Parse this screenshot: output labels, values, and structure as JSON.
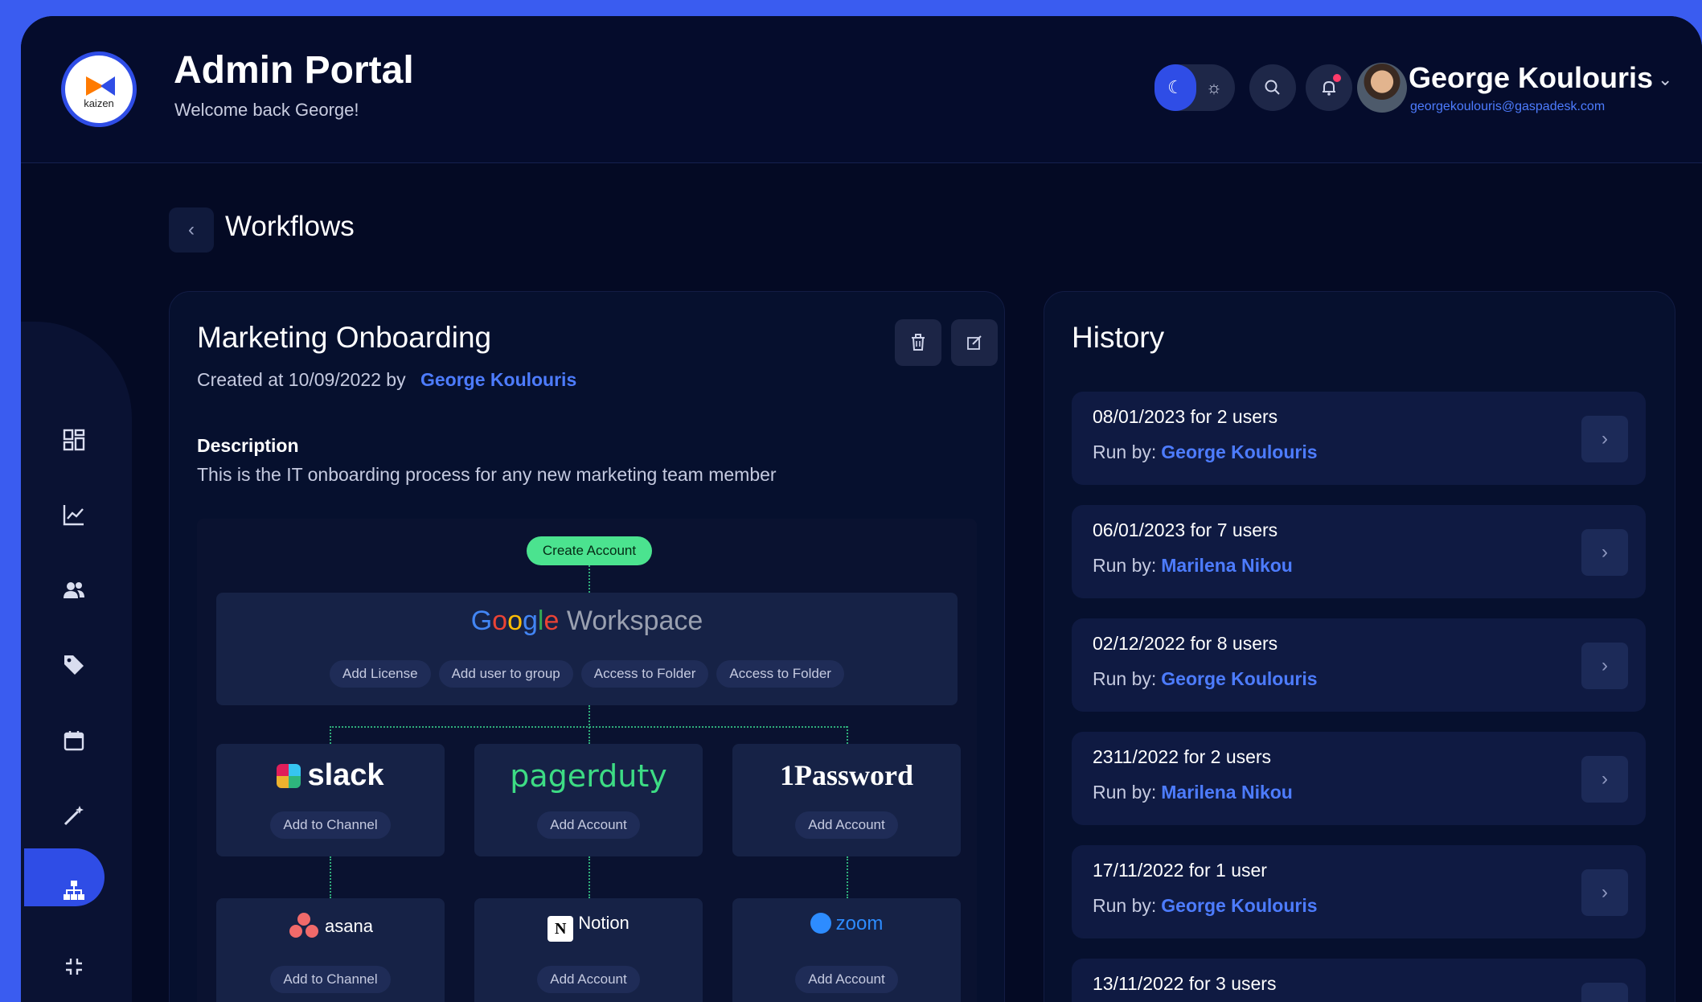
{
  "header": {
    "logo_text": "kaizen",
    "title": "Admin Portal",
    "subtitle": "Welcome back George!",
    "user_name": "George Koulouris",
    "user_email": "georgekoulouris@gaspadesk.com"
  },
  "icons": {
    "theme_dark": "moon-icon",
    "theme_light": "sun-icon",
    "search": "search-icon",
    "notifications": "bell-icon",
    "user_menu": "chevron-down-icon",
    "back": "chevron-left-icon",
    "delete": "trash-icon",
    "edit": "edit-icon",
    "history_open": "chevron-right-icon"
  },
  "sidebar": {
    "items": [
      {
        "icon": "dashboard-icon"
      },
      {
        "icon": "chart-icon"
      },
      {
        "icon": "users-icon"
      },
      {
        "icon": "tag-icon"
      },
      {
        "icon": "calendar-icon"
      },
      {
        "icon": "magic-wand-icon"
      },
      {
        "icon": "workflow-icon",
        "active": true
      },
      {
        "icon": "collapse-icon"
      }
    ]
  },
  "page": {
    "title": "Workflows"
  },
  "workflow": {
    "title": "Marketing Onboarding",
    "created_text": "Created at 10/09/2022 by",
    "author": "George Koulouris",
    "description_label": "Description",
    "description": "This is the IT onboarding process for any new marketing team member",
    "trigger": "Create Account",
    "google": {
      "G": "G",
      "o1": "o",
      "o2": "o",
      "g": "g",
      "l": "l",
      "e": "e",
      "product": " Workspace",
      "actions": [
        "Add License",
        "Add user to group",
        "Access to Folder",
        "Access to Folder"
      ]
    },
    "apps": [
      {
        "name": "slack",
        "action": "Add to Channel"
      },
      {
        "name": "pagerduty",
        "action": "Add Account"
      },
      {
        "name": "1Password",
        "action": "Add Account"
      },
      {
        "name": "asana",
        "action": "Add to Channel"
      },
      {
        "name": "Notion",
        "action": "Add Account"
      },
      {
        "name": "zoom",
        "action": "Add Account"
      }
    ]
  },
  "history": {
    "title": "History",
    "run_by_label": "Run by:",
    "items": [
      {
        "date": "08/01/2023 for 2 users",
        "user": "George Koulouris"
      },
      {
        "date": "06/01/2023 for 7 users",
        "user": "Marilena Nikou"
      },
      {
        "date": "02/12/2022 for 8 users",
        "user": "George Koulouris"
      },
      {
        "date": "2311/2022 for 2 users",
        "user": "Marilena Nikou"
      },
      {
        "date": "17/11/2022 for 1 user",
        "user": "George Koulouris"
      },
      {
        "date": "13/11/2022 for 3 users",
        "user": ""
      }
    ]
  },
  "colors": {
    "accent": "#2f4de6",
    "link": "#4d7cff",
    "trigger": "#4be38f",
    "background": "#040a24"
  }
}
